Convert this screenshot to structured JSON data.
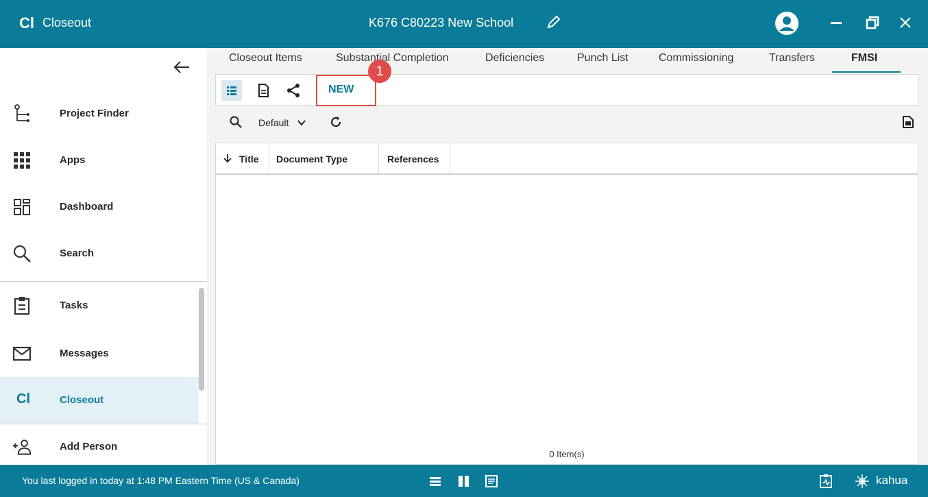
{
  "titlebar": {
    "app_abbr": "Cl",
    "app_name": "Closeout",
    "project_title": "K676 C80223 New School"
  },
  "sidebar": {
    "items": [
      {
        "label": "Project Finder",
        "icon": "project-finder-icon"
      },
      {
        "label": "Apps",
        "icon": "apps-grid-icon"
      },
      {
        "label": "Dashboard",
        "icon": "dashboard-icon"
      },
      {
        "label": "Search",
        "icon": "search-icon"
      },
      {
        "label": "Tasks",
        "icon": "clipboard-icon"
      },
      {
        "label": "Messages",
        "icon": "envelope-icon"
      },
      {
        "label": "Closeout",
        "icon_text": "Cl",
        "active": true
      },
      {
        "label": "Add Person",
        "icon": "add-person-icon"
      }
    ]
  },
  "tabs": [
    {
      "label": "Closeout Items"
    },
    {
      "label": "Substantial Completion"
    },
    {
      "label": "Deficiencies"
    },
    {
      "label": "Punch List"
    },
    {
      "label": "Commissioning"
    },
    {
      "label": "Transfers"
    },
    {
      "label": "FMSI",
      "active": true
    }
  ],
  "toolbar": {
    "new_label": "NEW",
    "callout_number": "1"
  },
  "filter": {
    "view_label": "Default"
  },
  "grid": {
    "columns": [
      "Title",
      "Document Type",
      "References"
    ],
    "count_text": "0 Item(s)"
  },
  "statusbar": {
    "message": "You last logged in today at 1:48 PM Eastern Time (US & Canada)",
    "brand": "kahua"
  },
  "colors": {
    "primary": "#0a7c99",
    "callout": "#e04b4b",
    "active_bg": "#e3f0f5"
  }
}
